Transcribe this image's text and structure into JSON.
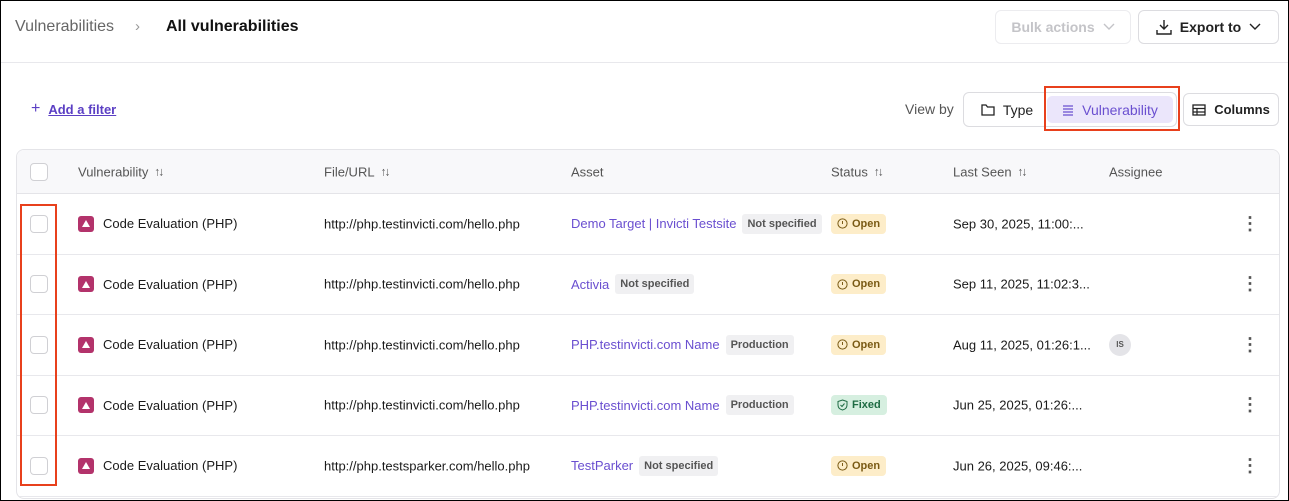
{
  "breadcrumb": {
    "parent": "Vulnerabilities",
    "separator": "›",
    "current": "All vulnerabilities"
  },
  "toolbar": {
    "bulk_actions": "Bulk actions",
    "export_to": "Export to",
    "add_filter": "Add a filter",
    "view_by": "View by",
    "view_type": "Type",
    "view_vulnerability": "Vulnerability",
    "columns": "Columns",
    "view_selected": "Vulnerability"
  },
  "colors": {
    "accent": "#6a4fd0",
    "highlight": "#e8401c",
    "severity": "#b3336b"
  },
  "table": {
    "headers": {
      "vulnerability": "Vulnerability",
      "file_url": "File/URL",
      "asset": "Asset",
      "status": "Status",
      "last_seen": "Last Seen",
      "assignee": "Assignee"
    },
    "rows": [
      {
        "vulnerability": "Code Evaluation (PHP)",
        "file_url": "http://php.testinvicti.com/hello.php",
        "asset": "Demo Target | Invicti Testsite",
        "env": "Not specified",
        "status": "Open",
        "last_seen": "Sep 30, 2025, 11:00:...",
        "assignee": ""
      },
      {
        "vulnerability": "Code Evaluation (PHP)",
        "file_url": "http://php.testinvicti.com/hello.php",
        "asset": "Activia",
        "env": "Not specified",
        "status": "Open",
        "last_seen": "Sep 11, 2025, 11:02:3...",
        "assignee": ""
      },
      {
        "vulnerability": "Code Evaluation (PHP)",
        "file_url": "http://php.testinvicti.com/hello.php",
        "asset": "PHP.testinvicti.com Name",
        "env": "Production",
        "status": "Open",
        "last_seen": "Aug 11, 2025, 01:26:1...",
        "assignee": "IS"
      },
      {
        "vulnerability": "Code Evaluation (PHP)",
        "file_url": "http://php.testinvicti.com/hello.php",
        "asset": "PHP.testinvicti.com Name",
        "env": "Production",
        "status": "Fixed",
        "last_seen": "Jun 25, 2025, 01:26:...",
        "assignee": ""
      },
      {
        "vulnerability": "Code Evaluation (PHP)",
        "file_url": "http://php.testsparker.com/hello.php",
        "asset": "TestParker",
        "env": "Not specified",
        "status": "Open",
        "last_seen": "Jun 26, 2025, 09:46:...",
        "assignee": ""
      }
    ]
  }
}
